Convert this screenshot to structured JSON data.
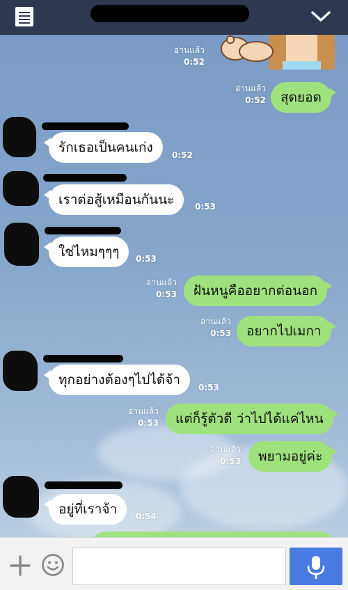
{
  "header": {
    "menu_icon": "menu-icon",
    "collapse_icon": "chevron-down-icon"
  },
  "chat": {
    "sticker": {
      "read_label": "อ่านแล้ว",
      "time": "0:52"
    },
    "messages": [
      {
        "text": "สุดยอด",
        "read_label": "อ่านแล้ว",
        "time": "0:52"
      },
      {
        "text": "รักเธอเป็นคนเก่ง",
        "time": "0:52"
      },
      {
        "text": "เราต่อสู้เหมือนกันนะ",
        "time": "0:53"
      },
      {
        "text": "ใช่ไหมๆๆๆ",
        "time": "0:53"
      },
      {
        "text": "ฝันหนูคืออยากต่อนอก",
        "read_label": "อ่านแล้ว",
        "time": "0:53"
      },
      {
        "text": "อยากไปเมกา",
        "read_label": "อ่านแล้ว",
        "time": "0:53"
      },
      {
        "text": "ทุกอย่างต้องๆไปได้จ้า",
        "time": "0:53"
      },
      {
        "text": "แต่ก็รู้ตัวดี ว่าไปได้แค่ไหน",
        "read_label": "อ่านแล้ว",
        "time": "0:53"
      },
      {
        "text": "พยามอยู่ค่ะ",
        "read_label": "อ่านแล้ว",
        "time": "0:53"
      },
      {
        "text": "อยู่ที่เราจ้า",
        "time": "0:54"
      }
    ]
  },
  "input": {
    "placeholder": "",
    "value": ""
  },
  "colors": {
    "header": "#2e3950",
    "outgoing_bubble": "#9ee27e",
    "incoming_bubble": "#ffffff",
    "send_button": "#4a7be2"
  }
}
